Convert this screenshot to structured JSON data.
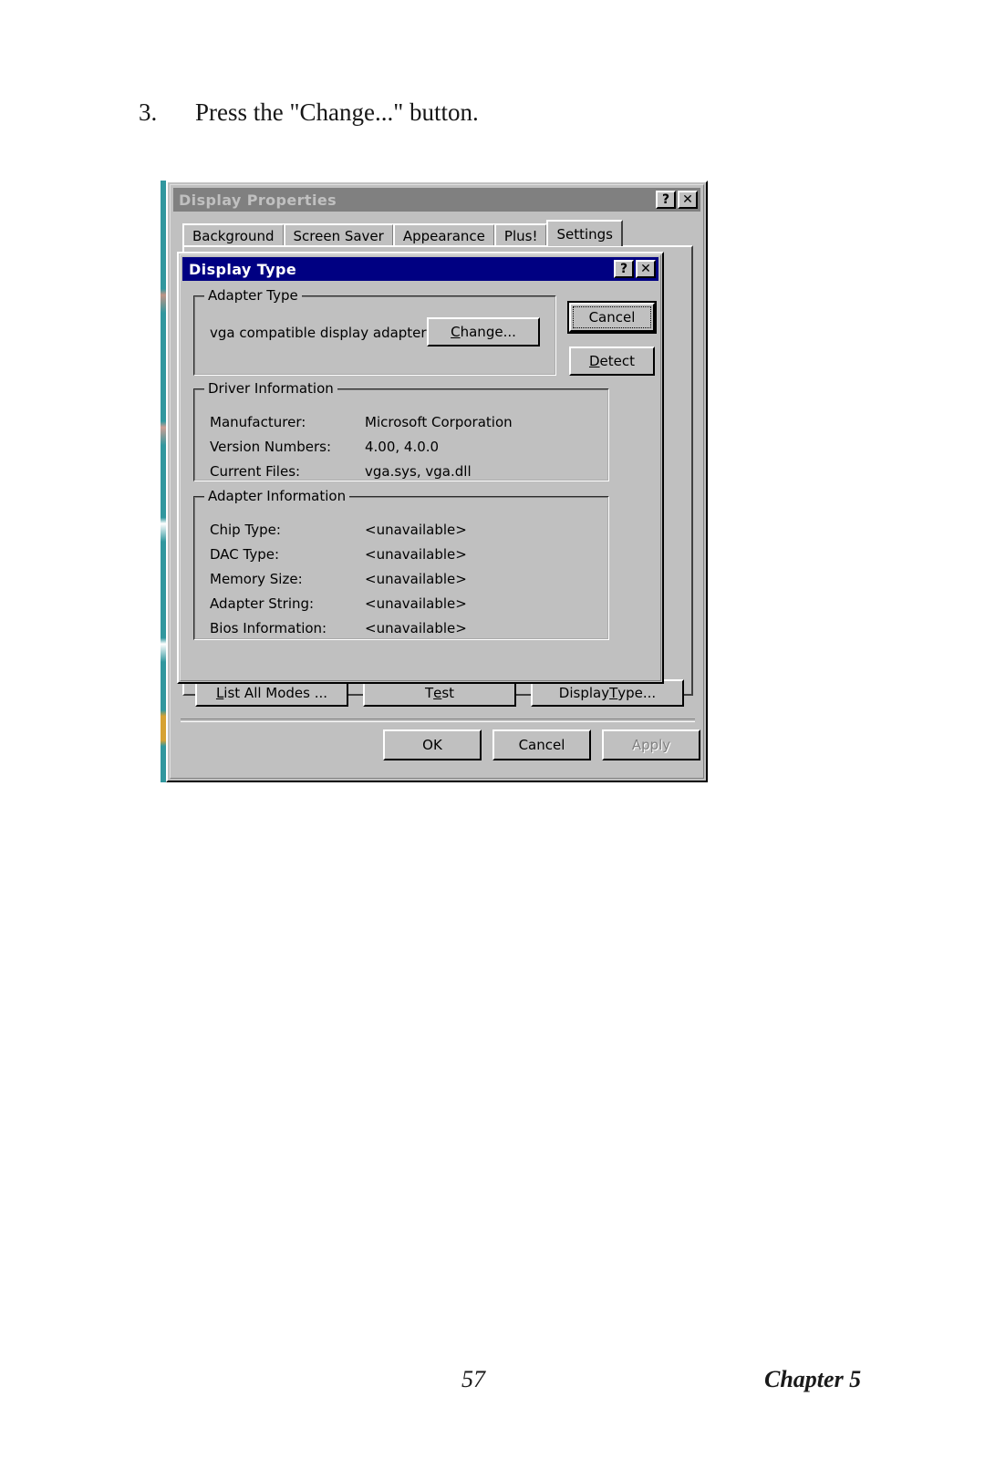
{
  "document": {
    "step_number": "3.",
    "step_text": "Press the \"Change...\" button.",
    "page_number": "57",
    "chapter_label": "Chapter 5"
  },
  "colors": {
    "face": "#c0c0c0",
    "active_title": "#000082",
    "inactive_title": "#808080",
    "title_text_active": "#ffffff",
    "title_text_inactive": "#c0c0c0",
    "disabled_text": "#808080",
    "scan_artifact": "#1f8e96"
  },
  "display_properties_window": {
    "title": "Display Properties",
    "state": "inactive",
    "titlebar_buttons": [
      {
        "name": "help-button",
        "glyph": "?"
      },
      {
        "name": "close-button",
        "glyph": "✕"
      }
    ],
    "tabs": [
      {
        "label": "Background",
        "active": false
      },
      {
        "label": "Screen Saver",
        "active": false
      },
      {
        "label": "Appearance",
        "active": false
      },
      {
        "label": "Plus!",
        "active": false
      },
      {
        "label": "Settings",
        "active": true
      }
    ],
    "settings_buttons": [
      {
        "label_pre": "L",
        "label_accel": "",
        "label": "List All Modes ...",
        "accel_index": 0
      },
      {
        "label": "Test",
        "accel_index": 1
      },
      {
        "label": "Display Type...",
        "accel_index": 8
      }
    ],
    "dialog_buttons": [
      {
        "label": "OK",
        "enabled": true
      },
      {
        "label": "Cancel",
        "enabled": true
      },
      {
        "label": "Apply",
        "enabled": false
      }
    ]
  },
  "display_type_dialog": {
    "title": "Display Type",
    "state": "active",
    "titlebar_buttons": [
      {
        "name": "help-button",
        "glyph": "?"
      },
      {
        "name": "close-button",
        "glyph": "✕"
      }
    ],
    "adapter_type": {
      "legend": "Adapter Type",
      "adapter_name": "vga compatible display adapter",
      "change_button": "Change..."
    },
    "side_buttons": [
      {
        "label": "Cancel",
        "focused": true,
        "default": true
      },
      {
        "label": "Detect",
        "focused": false,
        "default": false
      }
    ],
    "driver_information": {
      "legend": "Driver Information",
      "rows": [
        {
          "label": "Manufacturer:",
          "value": "Microsoft Corporation"
        },
        {
          "label": "Version Numbers:",
          "value": "4.00, 4.0.0"
        },
        {
          "label": "Current Files:",
          "value": "vga.sys, vga.dll"
        }
      ]
    },
    "adapter_information": {
      "legend": "Adapter Information",
      "rows": [
        {
          "label": "Chip Type:",
          "value": "<unavailable>"
        },
        {
          "label": "DAC Type:",
          "value": "<unavailable>"
        },
        {
          "label": "Memory Size:",
          "value": "<unavailable>"
        },
        {
          "label": "Adapter String:",
          "value": "<unavailable>"
        },
        {
          "label": "Bios Information:",
          "value": "<unavailable>"
        }
      ]
    }
  }
}
